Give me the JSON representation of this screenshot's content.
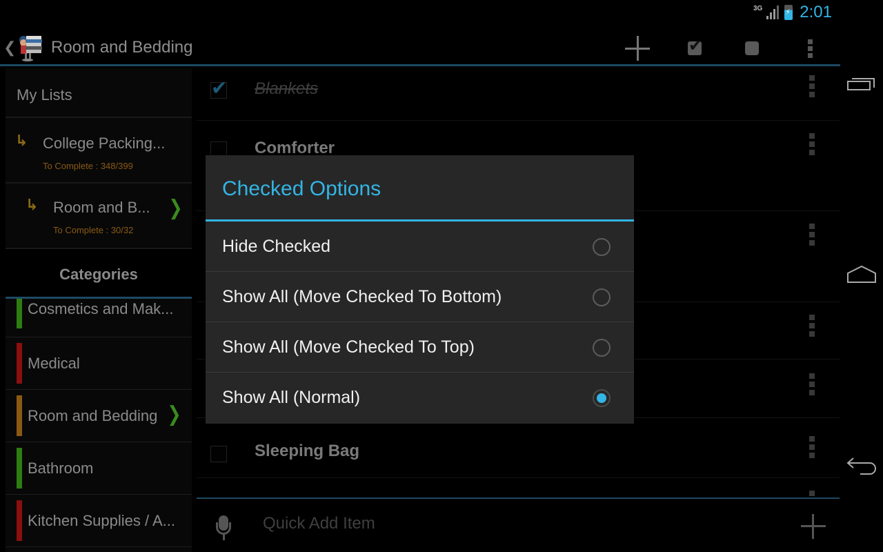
{
  "status_bar": {
    "network": "3G",
    "time": "2:01",
    "accent_color": "#33b5e5"
  },
  "action_bar": {
    "title": "Room and Bedding",
    "icons": [
      "back-icon",
      "app-logo",
      "add-icon",
      "check-all-icon",
      "uncheck-all-icon",
      "overflow-menu-icon"
    ]
  },
  "drawer": {
    "header": "My Lists",
    "lists": [
      {
        "name": "College Packing...",
        "subtitle": "To Complete : 348/399",
        "selected": false
      },
      {
        "name": "Room and B...",
        "subtitle": "To Complete : 30/32",
        "selected": true
      }
    ],
    "categories_header": "Categories",
    "categories": [
      {
        "name": "Cosmetics and Mak...",
        "color": "#2e7d12",
        "selected": false
      },
      {
        "name": "Medical",
        "color": "#8b0f0f",
        "selected": false
      },
      {
        "name": "Room and Bedding",
        "color": "#8a5a14",
        "selected": true
      },
      {
        "name": "Bathroom",
        "color": "#2e7d12",
        "selected": false
      },
      {
        "name": "Kitchen Supplies / A...",
        "color": "#8b0f0f",
        "selected": false
      }
    ]
  },
  "items": [
    {
      "label": "Blankets",
      "checked": true
    },
    {
      "label": "Comforter",
      "checked": false
    },
    {
      "label": "",
      "checked": false
    },
    {
      "label": "",
      "checked": false
    },
    {
      "label": "",
      "checked": false
    },
    {
      "label": "Sleeping Bag",
      "checked": false
    }
  ],
  "quick_add": {
    "placeholder": "Quick Add Item",
    "value": ""
  },
  "dialog": {
    "title": "Checked Options",
    "options": [
      {
        "label": "Hide Checked",
        "selected": false
      },
      {
        "label": "Show All (Move Checked To Bottom)",
        "selected": false
      },
      {
        "label": "Show All (Move Checked To Top)",
        "selected": false
      },
      {
        "label": "Show All (Normal)",
        "selected": true
      }
    ]
  },
  "nav_bar": {
    "buttons": [
      "recent-apps",
      "home",
      "back"
    ]
  }
}
